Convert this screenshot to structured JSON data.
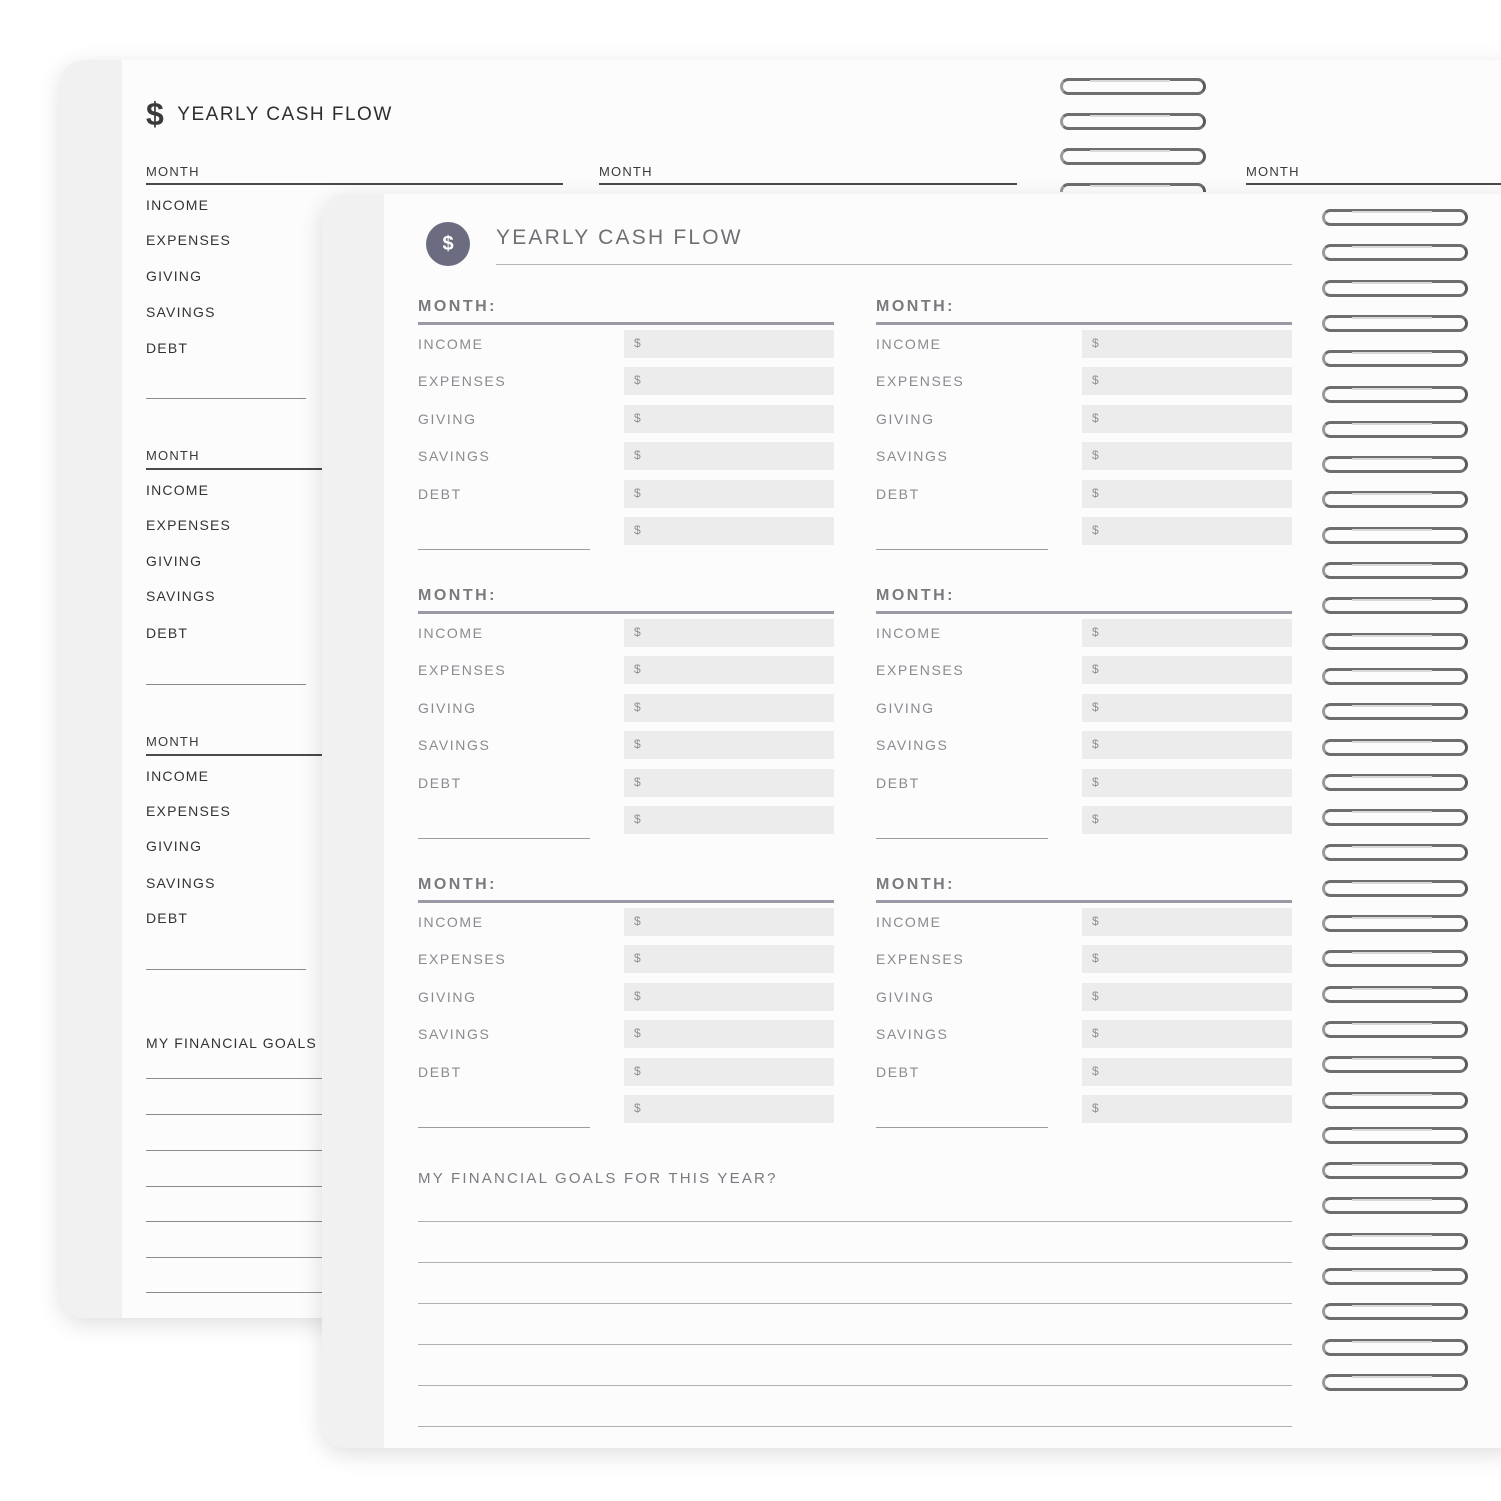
{
  "back_page": {
    "title": "YEARLY CASH FLOW",
    "dollar_symbol": "$",
    "month_label": "MONTH",
    "rows": [
      "INCOME",
      "EXPENSES",
      "GIVING",
      "SAVINGS",
      "DEBT"
    ],
    "goals_label": "MY FINANCIAL GOALS"
  },
  "front_page": {
    "title": "YEARLY CASH FLOW",
    "icon_symbol": "$",
    "month_label": "MONTH:",
    "rows": [
      "INCOME",
      "EXPENSES",
      "GIVING",
      "SAVINGS",
      "DEBT"
    ],
    "currency_symbol": "$",
    "goals_label": "MY FINANCIAL GOALS FOR THIS YEAR?"
  },
  "colors": {
    "icon_circle": "#6b6c80",
    "field_fill": "#ececec",
    "month_rule": "#9a9aa6"
  },
  "icons": [
    "dollar-icon",
    "dollar-circle-icon",
    "spiral-binding-icon"
  ]
}
